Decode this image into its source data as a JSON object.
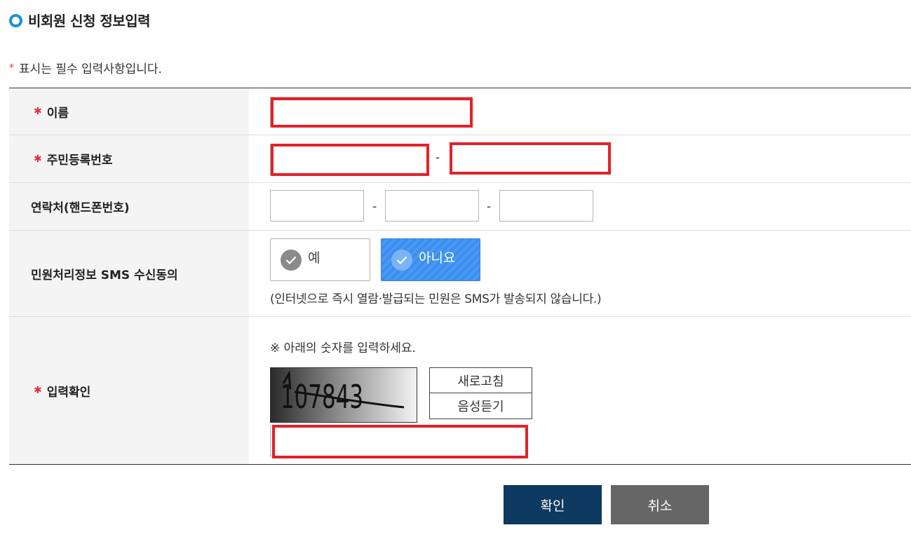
{
  "page": {
    "title": "비회원 신청 정보입력"
  },
  "required_note": {
    "star": "*",
    "text": "표시는 필수 입력사항입니다."
  },
  "form": {
    "name": {
      "label": "이름",
      "required": true
    },
    "rrn": {
      "label": "주민등록번호",
      "required": true,
      "separator": "-"
    },
    "phone": {
      "label": "연락처(핸드폰번호)",
      "required": false,
      "separator": "-"
    },
    "sms": {
      "label": "민원처리정보 SMS 수신동의",
      "options": [
        {
          "label": "예",
          "selected": false
        },
        {
          "label": "아니요",
          "selected": true
        }
      ],
      "note": "(인터넷으로 즉시 열람·발급되는 민원은 SMS가 발송되지 않습니다.)"
    },
    "captcha": {
      "label": "입력확인",
      "required": true,
      "instruction": "※ 아래의 숫자를 입력하세요.",
      "image_text": "107843",
      "refresh_label": "새로고침",
      "audio_label": "음성듣기"
    }
  },
  "actions": {
    "confirm_label": "확인",
    "cancel_label": "취소"
  },
  "colors": {
    "accent": "#1f8fd8",
    "required": "#e0313b",
    "highlight": "#e32129",
    "selected": "#3b8ef0",
    "confirm": "#0e3960",
    "cancel": "#666666"
  }
}
